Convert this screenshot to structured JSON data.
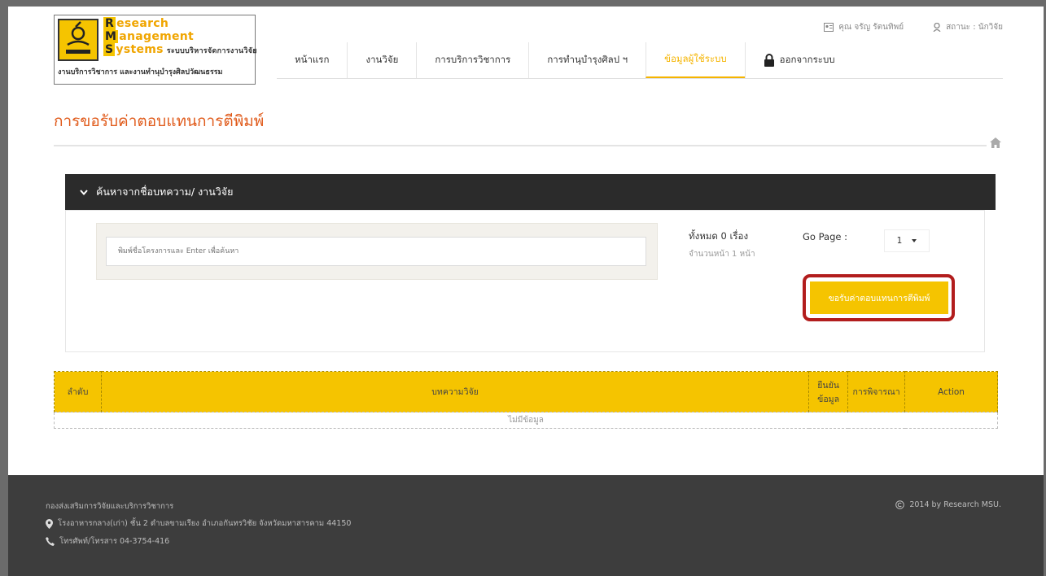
{
  "logo": {
    "line1_cap": "R",
    "line1_rest": "esearch",
    "line2_cap": "M",
    "line2_rest": "anagement",
    "line3_cap": "S",
    "line3_rest": "ystems",
    "thai_title": "ระบบบริหารจัดการงานวิจัย",
    "thai_sub": "งานบริการวิชาการ และงานทำนุบำรุงศิลปวัฒนธรรม"
  },
  "userbar": {
    "user": "คุณ จรัญ รัตนทิพย์",
    "status": "สถานะ : นักวิจัย"
  },
  "nav": {
    "items": [
      "หน้าแรก",
      "งานวิจัย",
      "การบริการวิชาการ",
      "การทำนุบำรุงศิลป ฯ",
      "ข้อมูลผู้ใช้ระบบ"
    ],
    "logout": "ออกจากระบบ"
  },
  "page_title": "การขอรับค่าตอบแทนการตีพิมพ์",
  "search": {
    "header": "ค้นหาจากชื่อบทความ/ งานวิจัย",
    "placeholder": "พิมพ์ชื่อโครงการและ Enter เพื่อค้นหา",
    "count": "ทั้งหมด 0 เรื่อง",
    "pages": "จำนวนหน้า 1 หน้า",
    "go_label": "Go Page :",
    "page_value": "1",
    "request_button": "ขอรับค่าตอบแทนการตีพิมพ์"
  },
  "table": {
    "headers": [
      "ลำดับ",
      "บทความวิจัย",
      "ยืนยันข้อมูล",
      "การพิจารณา",
      "Action"
    ],
    "empty": "ไม่มีข้อมูล"
  },
  "footer": {
    "org": "กองส่งเสริมการวิจัยและบริการวิชาการ",
    "address": "โรงอาหารกลาง(เก่า) ชั้น 2 ตำบลขามเรียง อำเภอกันทรวิชัย จังหวัดมหาสารคาม 44150",
    "tel": "โทรศัพท์/โทรสาร 04-3754-416",
    "copyright": "2014 by Research MSU."
  },
  "colors": {
    "accent": "#f5c400",
    "title": "#e05a1a",
    "highlight_outline": "#b21d1d",
    "dark_bar": "#2b2b2b",
    "footer": "#3d3d3d"
  }
}
